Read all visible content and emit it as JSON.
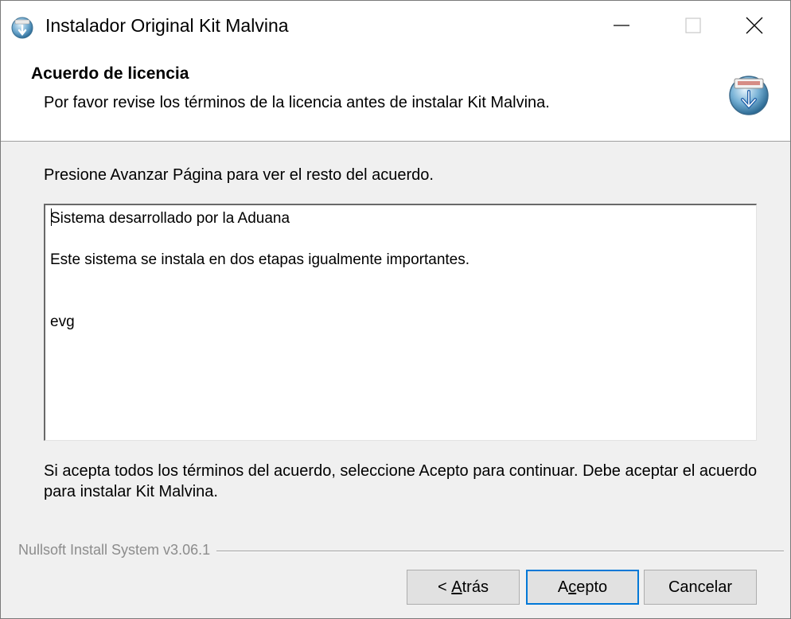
{
  "window": {
    "title": "Instalador Original Kit Malvina",
    "icon": "installer-globe-icon"
  },
  "title_buttons": {
    "minimize": "minimize-icon",
    "maximize": "maximize-icon",
    "close": "close-icon"
  },
  "header": {
    "title": "Acuerdo de licencia",
    "subtitle": "Por favor revise los términos de la licencia antes de instalar Kit Malvina.",
    "icon": "nsis-installer-icon"
  },
  "body": {
    "instruction": "Presione Avanzar Página para ver el resto del acuerdo.",
    "license_lines": [
      "Sistema desarrollado por la Aduana",
      "Este sistema se instala en dos etapas igualmente importantes.",
      "evg"
    ],
    "accept_text": "Si acepta todos los términos del acuerdo, seleccione Acepto para continuar. Debe aceptar el acuerdo para instalar Kit Malvina."
  },
  "footer": {
    "brand": "Nullsoft Install System v3.06.1",
    "buttons": {
      "back_prefix": "< ",
      "back_mnemonic": "A",
      "back_rest": "trás",
      "accept_prefix": "A",
      "accept_mnemonic": "c",
      "accept_rest": "epto",
      "cancel": "Cancelar"
    }
  },
  "colors": {
    "accent": "#0078d7",
    "dialog_bg": "#f0f0f0",
    "button_bg": "#e1e1e1"
  }
}
